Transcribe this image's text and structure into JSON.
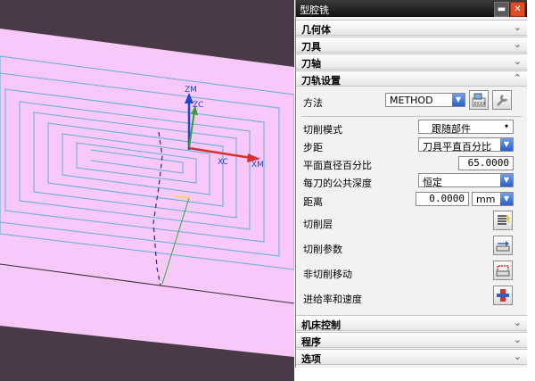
{
  "window": {
    "title": "型腔铣"
  },
  "viewport": {
    "labels": {
      "zm": "ZM",
      "zc": "ZC",
      "xc": "XC",
      "xm": "XM"
    },
    "colors": {
      "background": "#f8c8f8",
      "band": "#4a3a48",
      "toolpath": "#5fb0d8",
      "zaxis": "#2048c8",
      "xaxis": "#d83030",
      "zc_axis": "#30a030"
    }
  },
  "panel": {
    "sections_top": [
      {
        "label": "几何体",
        "state": "collapsed"
      },
      {
        "label": "刀具",
        "state": "collapsed"
      },
      {
        "label": "刀轴",
        "state": "collapsed"
      },
      {
        "label": "刀轨设置",
        "state": "expanded"
      }
    ],
    "toolpath_settings": {
      "method": {
        "label": "方法",
        "value": "METHOD"
      },
      "cut_pattern": {
        "label": "切削模式",
        "value": "跟随部件"
      },
      "stepover": {
        "label": "步距",
        "value": "刀具平直百分比"
      },
      "flat_diameter_percent": {
        "label": "平面直径百分比",
        "value": "65.0000"
      },
      "common_depth": {
        "label": "每刀的公共深度",
        "value": "恒定"
      },
      "distance": {
        "label": "距离",
        "value": "0.0000",
        "unit": "mm"
      },
      "cut_levels": {
        "label": "切削层"
      },
      "cut_params": {
        "label": "切削参数"
      },
      "non_cutting_moves": {
        "label": "非切削移动"
      },
      "feeds_speeds": {
        "label": "进给率和速度"
      }
    },
    "sections_bottom": [
      {
        "label": "机床控制",
        "state": "collapsed"
      },
      {
        "label": "程序",
        "state": "collapsed"
      },
      {
        "label": "选项",
        "state": "collapsed"
      }
    ]
  },
  "icons": {
    "chevron_collapsed": "chevron-down",
    "chevron_expanded": "chevron-up",
    "dropdown": "triangle-down"
  }
}
